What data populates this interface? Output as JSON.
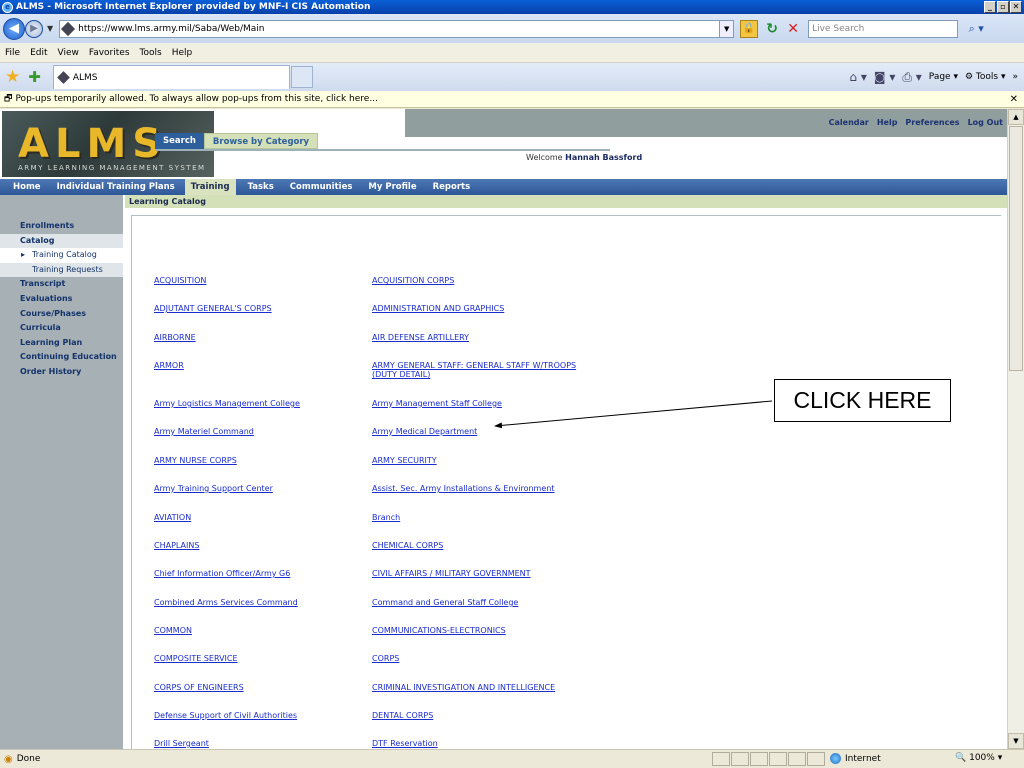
{
  "window": {
    "title": "ALMS - Microsoft Internet Explorer provided by MNF-I CIS Automation"
  },
  "address": {
    "url": "https://www.lms.army.mil/Saba/Web/Main",
    "search_placeholder": "Live Search"
  },
  "menu": [
    "File",
    "Edit",
    "View",
    "Favorites",
    "Tools",
    "Help"
  ],
  "tab": {
    "label": "ALMS"
  },
  "commandbar": {
    "page": "Page",
    "tools": "Tools"
  },
  "infobar": {
    "text": "Pop-ups temporarily allowed. To always allow pop-ups from this site, click here..."
  },
  "header": {
    "logo_big": "ALMS",
    "logo_small": "Army Learning Management System",
    "links": [
      "Calendar",
      "Help",
      "Preferences",
      "Log Out"
    ],
    "welcome_label": "Welcome",
    "user_name": "Hannah Bassford"
  },
  "nav": [
    "Home",
    "Individual Training Plans",
    "Training",
    "Tasks",
    "Communities",
    "My Profile",
    "Reports"
  ],
  "sidebar": {
    "enrollments": "Enrollments",
    "catalog": "Catalog",
    "training_catalog": "Training Catalog",
    "training_requests": "Training Requests",
    "transcript": "Transcript",
    "evaluations": "Evaluations",
    "course_phases": "Course/Phases",
    "curricula": "Curricula",
    "learning_plan": "Learning Plan",
    "continuing_education": "Continuing Education",
    "order_history": "Order History"
  },
  "breadcrumb": "Learning Catalog",
  "catalog_tabs": {
    "search": "Search",
    "browse": "Browse by Category"
  },
  "categories_left": [
    "ACQUISITION",
    "ADJUTANT GENERAL'S CORPS",
    "AIRBORNE",
    "ARMOR",
    "Army Logistics Management College",
    "Army Materiel Command",
    "ARMY NURSE CORPS",
    "Army Training Support Center",
    "AVIATION",
    "CHAPLAINS",
    "Chief Information Officer/Army G6",
    "Combined Arms Services Command",
    "COMMON",
    "COMPOSITE SERVICE",
    "CORPS OF ENGINEERS",
    "Defense Support of Civil Authorities",
    "Drill Sergeant"
  ],
  "categories_right": [
    "ACQUISITION CORPS",
    "ADMINISTRATION AND GRAPHICS",
    "AIR DEFENSE ARTILLERY",
    "ARMY GENERAL STAFF: GENERAL STAFF W/TROOPS",
    "Army Management Staff College",
    "Army Medical Department",
    "ARMY SECURITY",
    "Assist. Sec. Army Installations & Environment",
    "Branch",
    "CHEMICAL CORPS",
    "CIVIL AFFAIRS / MILITARY GOVERNMENT",
    "Command and General Staff College",
    "COMMUNICATIONS-ELECTRONICS",
    "CORPS",
    "CRIMINAL INVESTIGATION AND INTELLIGENCE",
    "DENTAL CORPS",
    "DTF Reservation"
  ],
  "category_right_wrap": "(DUTY DETAIL)",
  "callout": "CLICK HERE",
  "status": {
    "text": "Done",
    "zone": "Internet",
    "zoom": "100%"
  }
}
